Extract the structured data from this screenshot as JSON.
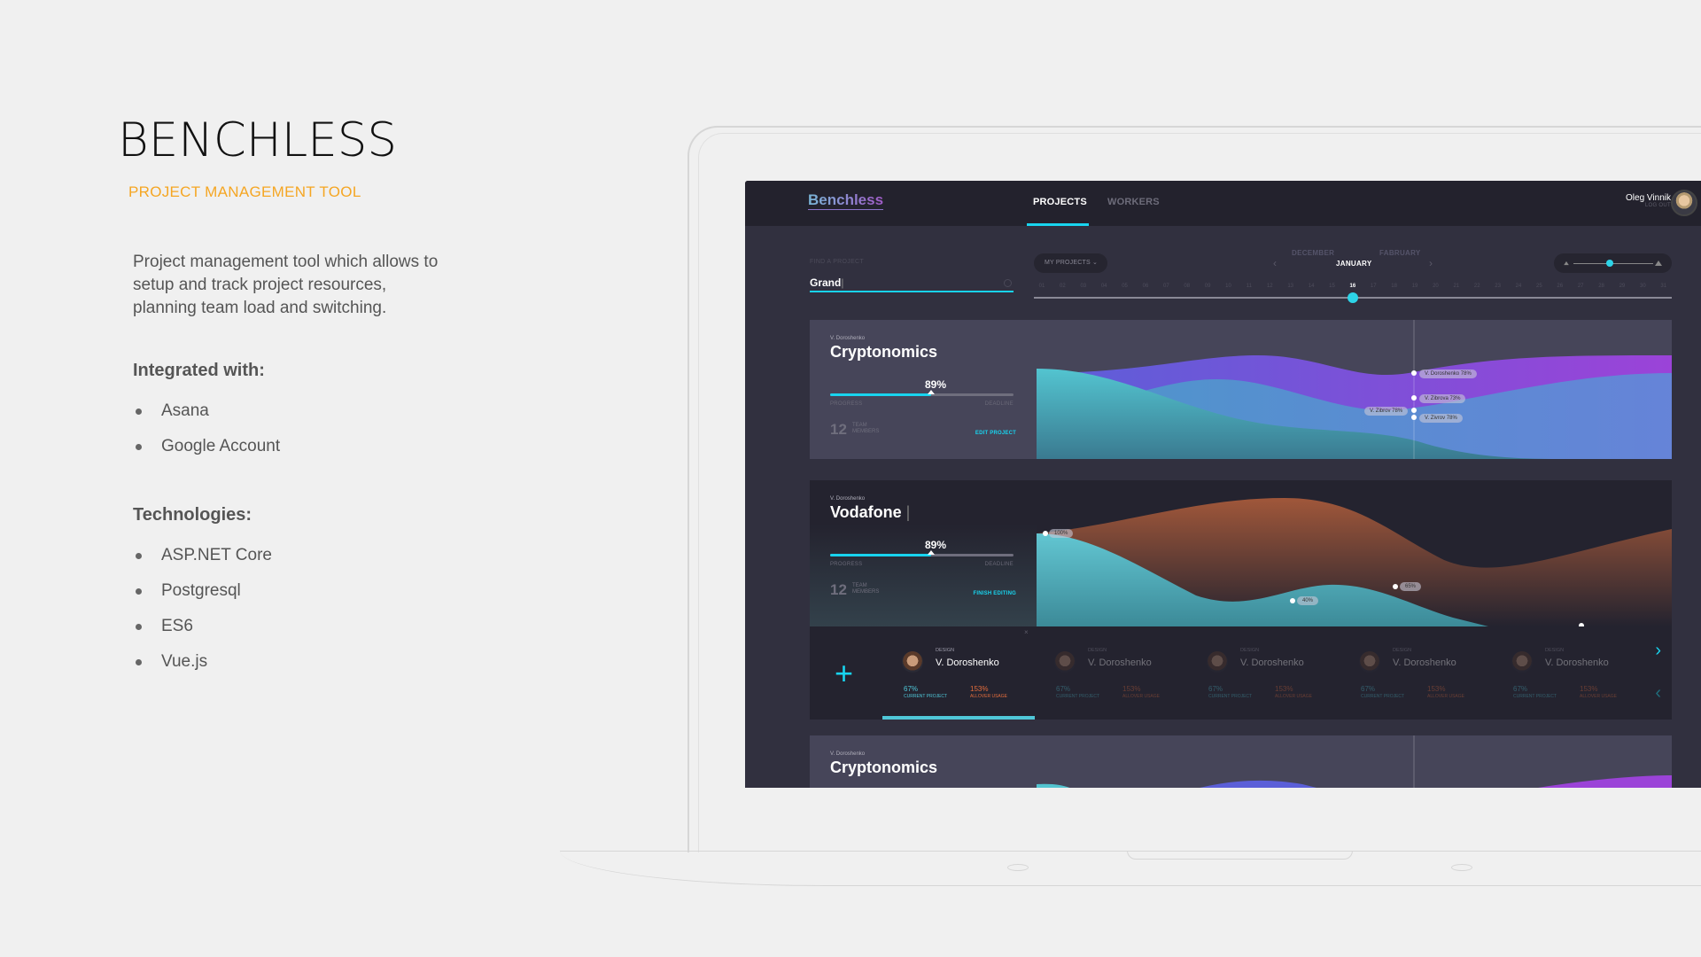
{
  "slide": {
    "title": "BENCHLESS",
    "subtitle": "PROJECT MANAGEMENT TOOL",
    "description": "Project management tool which allows to setup and track project resources, planning team load and switching.",
    "integrated_heading": "Integrated with:",
    "integrations": [
      "Asana",
      "Google Account"
    ],
    "tech_heading": "Technologies:",
    "technologies": [
      "ASP.NET Core",
      "Postgresql",
      "ES6",
      "Vue.js"
    ]
  },
  "app": {
    "logo": "Benchless",
    "tabs": [
      {
        "label": "PROJECTS",
        "active": true
      },
      {
        "label": "WORKERS",
        "active": false
      }
    ],
    "user": {
      "name": "Oleg Vinnik",
      "logout": "LOG OUT"
    },
    "search": {
      "label": "FIND A PROJECT",
      "value": "Grand"
    },
    "filter": {
      "label": "MY PROJECTS"
    },
    "months": {
      "prev": "DECEMBER",
      "current": "JANUARY",
      "next": "FABRUARY"
    },
    "days": [
      "01",
      "02",
      "03",
      "04",
      "05",
      "06",
      "07",
      "08",
      "09",
      "10",
      "11",
      "12",
      "13",
      "14",
      "15",
      "16",
      "17",
      "18",
      "19",
      "20",
      "21",
      "22",
      "23",
      "24",
      "25",
      "26",
      "27",
      "28",
      "29",
      "30",
      "31"
    ],
    "current_day": "16",
    "zoom_level": 0.45,
    "projects": [
      {
        "owner": "V. Doroshenko",
        "name": "Cryptonomics",
        "progress_pct": "89%",
        "progress": 0.55,
        "progress_label": "PROGRESS",
        "deadline_label": "DEADLINE",
        "team_count": "12",
        "team_label_1": "TEAM",
        "team_label_2": "MEMBERS",
        "action": "EDIT PROJECT",
        "tags": [
          {
            "text": "V. Doroshenko 78%"
          },
          {
            "text": "V. Zibrova 73%"
          },
          {
            "text": "V. Zibrov 78%"
          },
          {
            "text": "V. Zivrov 78%"
          }
        ]
      },
      {
        "owner": "V. Doroshenko",
        "name": "Vodafone",
        "progress_pct": "89%",
        "progress": 0.55,
        "progress_label": "PROGRESS",
        "deadline_label": "DEADLINE",
        "team_count": "12",
        "team_label_1": "TEAM",
        "team_label_2": "MEMBERS",
        "action": "FINISH EDITING",
        "tags": [
          {
            "text": "100%"
          },
          {
            "text": "40%"
          },
          {
            "text": "65%"
          }
        ]
      },
      {
        "owner": "V. Doroshenko",
        "name": "Cryptonomics"
      }
    ],
    "workers": [
      {
        "role": "DESIGN",
        "name": "V. Doroshenko",
        "current": "67%",
        "current_label": "CURRENT PROJECT",
        "allover": "153%",
        "allover_label": "ALLOVER USAGE"
      },
      {
        "role": "DESIGN",
        "name": "V. Doroshenko",
        "current": "67%",
        "current_label": "CURRENT PROJECT",
        "allover": "153%",
        "allover_label": "ALLOVER USAGE"
      },
      {
        "role": "DESIGN",
        "name": "V. Doroshenko",
        "current": "67%",
        "current_label": "CURRENT PROJECT",
        "allover": "153%",
        "allover_label": "ALLOVER USAGE"
      },
      {
        "role": "DESIGN",
        "name": "V. Doroshenko",
        "current": "67%",
        "current_label": "CURRENT PROJECT",
        "allover": "153%",
        "allover_label": "ALLOVER USAGE"
      },
      {
        "role": "DESIGN",
        "name": "V. Doroshenko",
        "current": "67%",
        "current_label": "CURRENT PROJECT",
        "allover": "153%",
        "allover_label": "ALLOVER USAGE"
      }
    ],
    "icons": {
      "add": "+",
      "next": "›",
      "prev": "‹",
      "close": "×",
      "chevron_down": "⌄"
    },
    "colors": {
      "accent": "#18d4ef",
      "usage": "#e46d3c",
      "bg": "#31303f",
      "topbar": "#23222d"
    }
  }
}
